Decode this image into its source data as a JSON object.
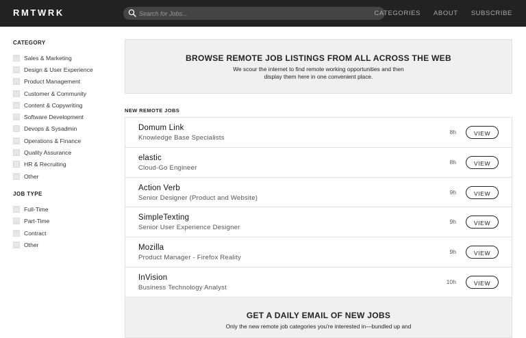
{
  "header": {
    "logo": "RMTWRK",
    "search_placeholder": "Search for Jobs...",
    "nav": [
      "CATEGORIES",
      "ABOUT",
      "SUBSCRIBE"
    ]
  },
  "sidebar": {
    "category_heading": "CATEGORY",
    "categories": [
      "Sales & Marketing",
      "Design & User Experience",
      "Product Management",
      "Customer & Community",
      "Content & Copywriting",
      "Software Development",
      "Devops & Sysadmin",
      "Operations & Finance",
      "Quality Assurance",
      "HR & Recruiting",
      "Other"
    ],
    "jobtype_heading": "JOB TYPE",
    "job_types": [
      "Full-Time",
      "Part-Time",
      "Contract",
      "Other"
    ]
  },
  "hero": {
    "title": "BROWSE REMOTE JOB LISTINGS FROM ALL ACROSS THE WEB",
    "text": "We scour the internet to find remote working opportunities and then display them here in one convenient place."
  },
  "jobs_section": {
    "label": "NEW REMOTE JOBS",
    "view_label": "VIEW",
    "jobs": [
      {
        "company": "Domum Link",
        "title": "Knowledge Base Specialists",
        "age": "8h"
      },
      {
        "company": "elastic",
        "title": "Cloud-Go Engineer",
        "age": "8h"
      },
      {
        "company": "Action Verb",
        "title": "Senior Designer (Product and Website)",
        "age": "9h"
      },
      {
        "company": "SimpleTexting",
        "title": "Senior User Experience Designer",
        "age": "9h"
      },
      {
        "company": "Mozilla",
        "title": "Product Manager - Firefox Reality",
        "age": "9h"
      },
      {
        "company": "InVision",
        "title": "Business Technology Analyst",
        "age": "10h"
      }
    ]
  },
  "email": {
    "title": "GET A DAILY EMAIL OF NEW JOBS",
    "text": "Only the new remote job categories you're interested in—bundled up and"
  }
}
